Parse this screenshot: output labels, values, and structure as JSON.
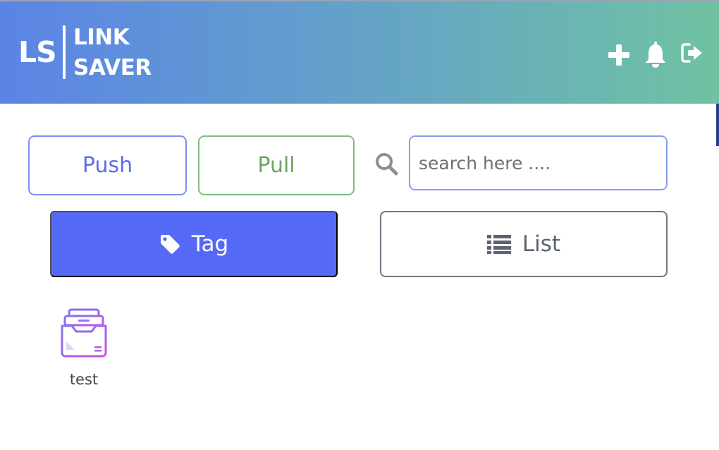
{
  "header": {
    "logo_mark": "LS",
    "logo_line1": "LINK",
    "logo_line2": "SAVER",
    "icons": [
      "plus-icon",
      "bell-icon",
      "sign-out-icon"
    ]
  },
  "toolbar": {
    "push_label": "Push",
    "pull_label": "Pull",
    "search_placeholder": "search here ....",
    "search_value": ""
  },
  "view_toggle": {
    "tag_label": "Tag",
    "list_label": "List",
    "active": "Tag"
  },
  "tags": [
    {
      "label": "test"
    }
  ],
  "colors": {
    "header_gradient_start": "#5b84e6",
    "header_gradient_end": "#70c2a2",
    "primary": "#5469f5",
    "push": "#5f6de8",
    "pull": "#6aa85e",
    "tag_icon": "#b05ee6"
  }
}
